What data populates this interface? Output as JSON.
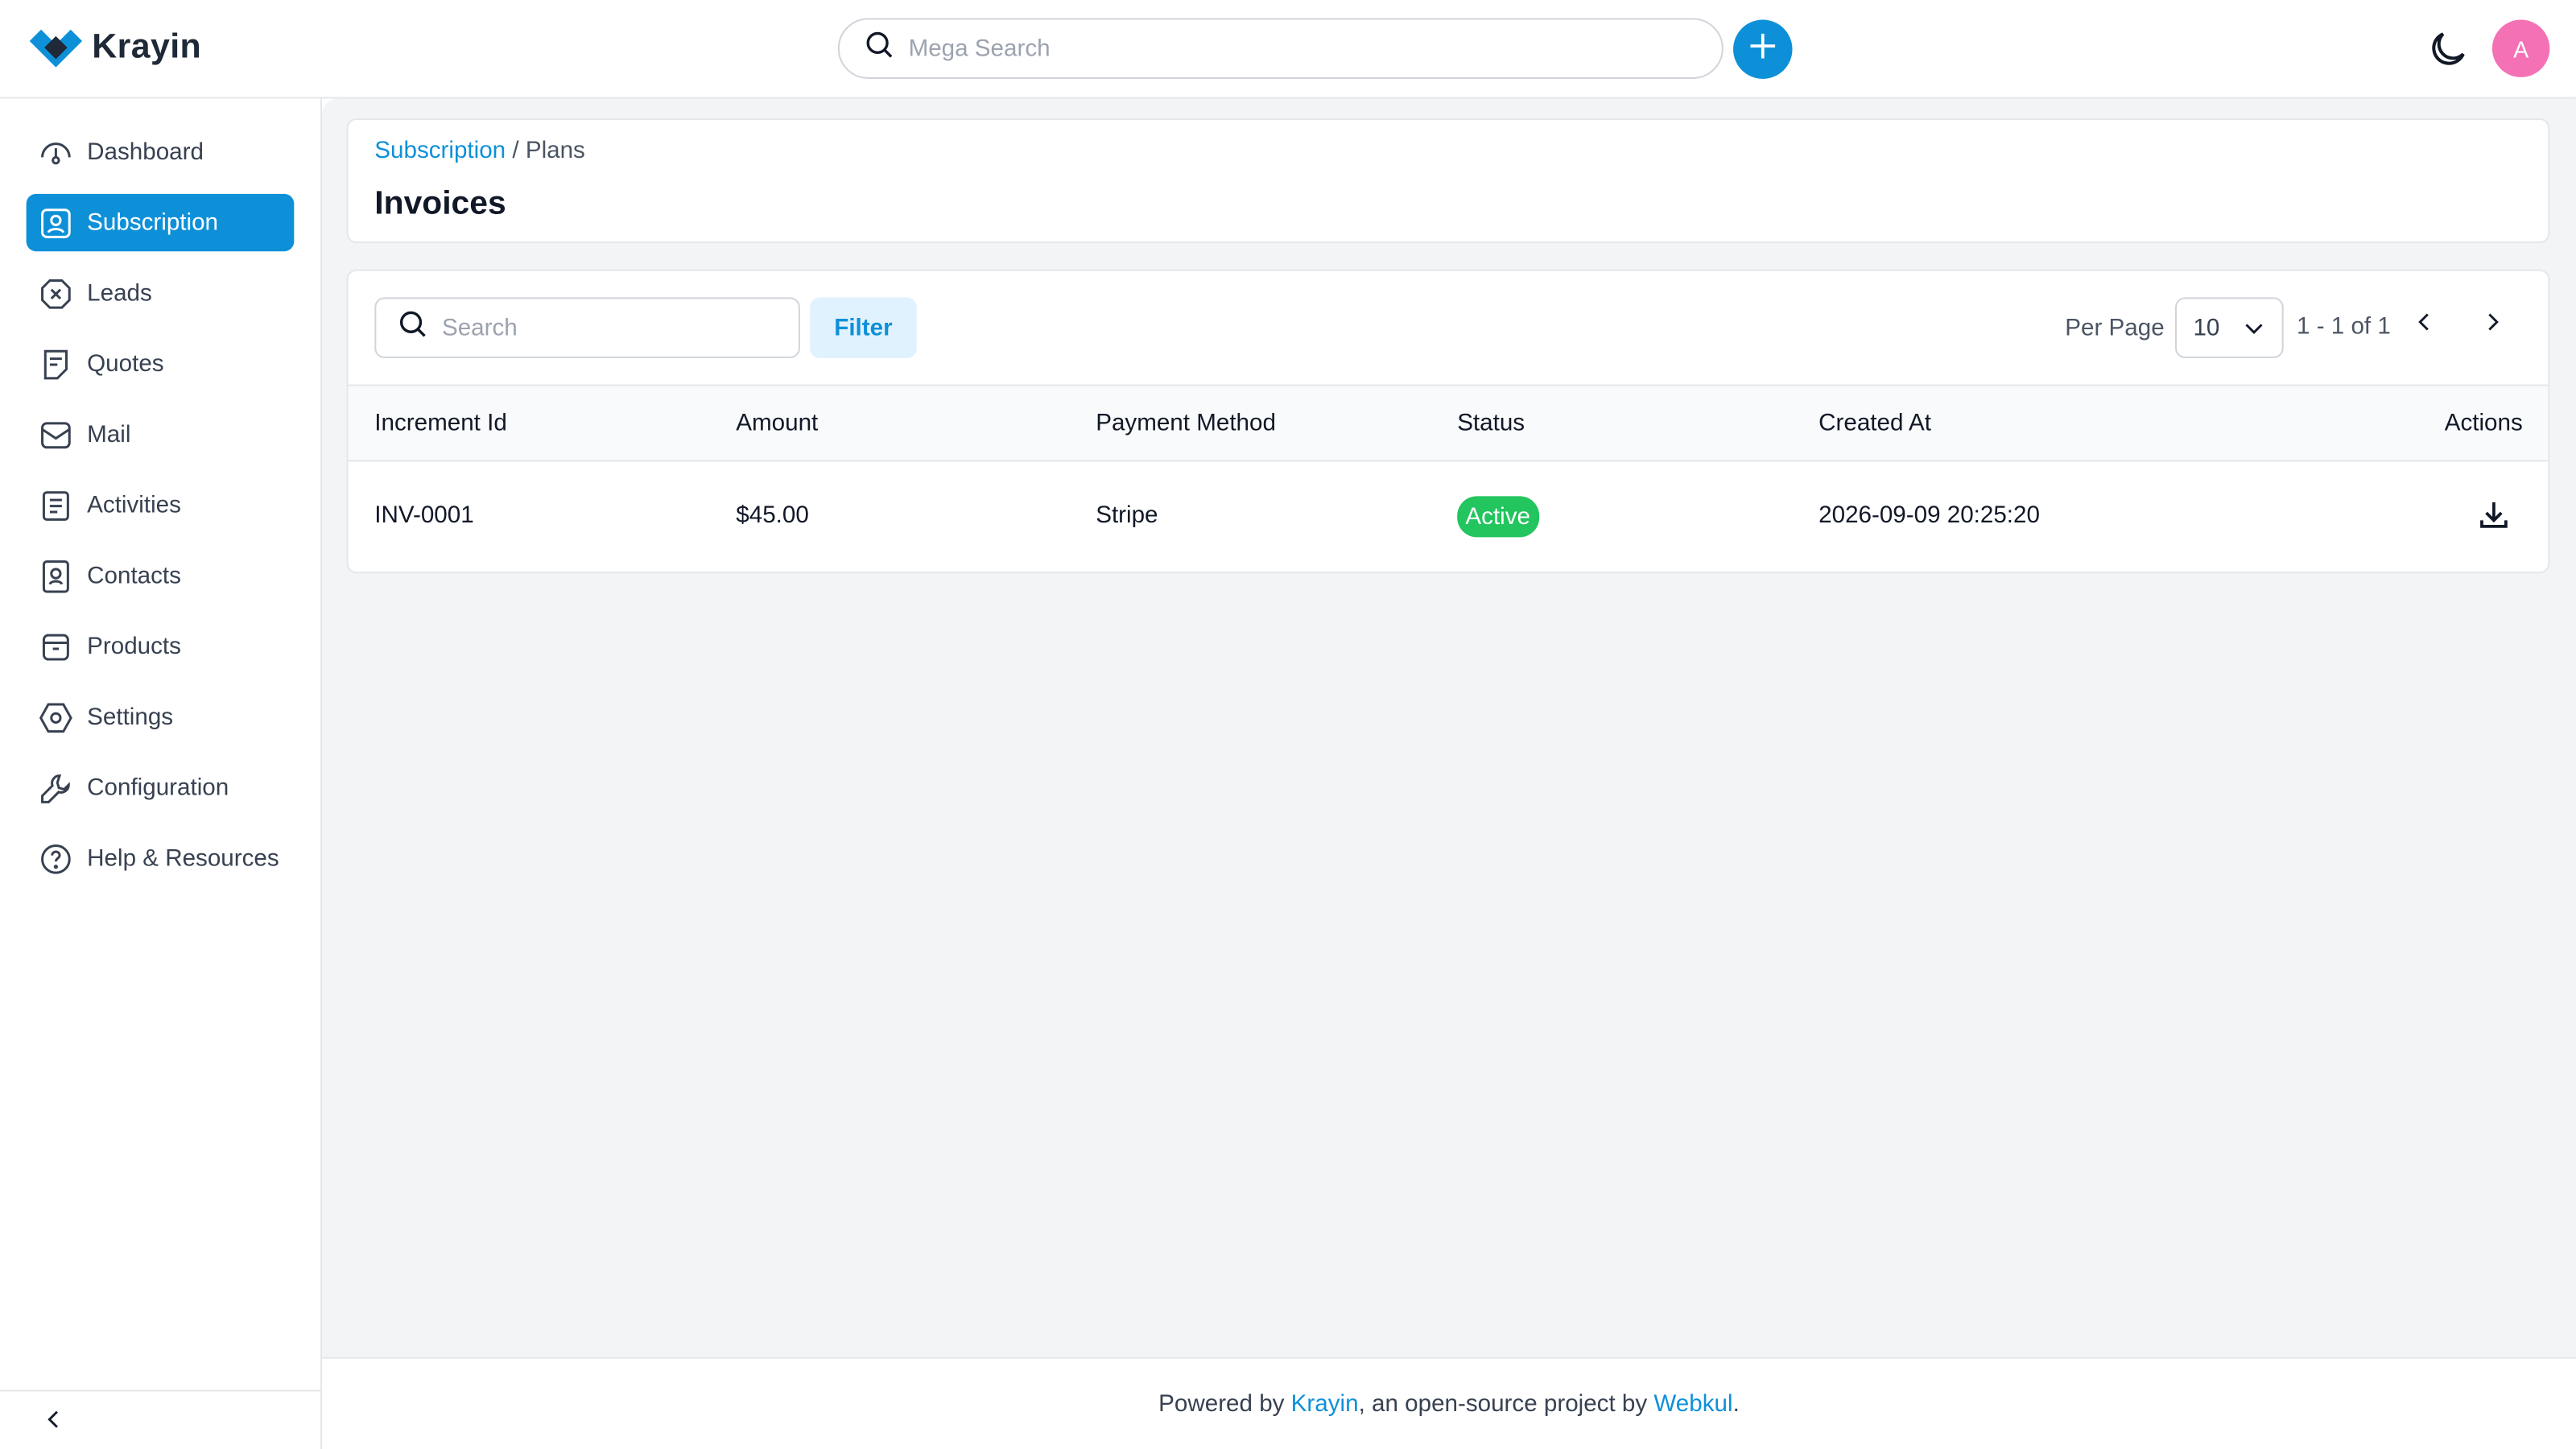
{
  "app": {
    "name": "Krayin",
    "brand_color": "#0e90d9"
  },
  "header": {
    "search_placeholder": "Mega Search",
    "avatar_initial": "A"
  },
  "sidebar": {
    "items": [
      {
        "label": "Dashboard",
        "icon": "dashboard-icon",
        "active": false
      },
      {
        "label": "Subscription",
        "icon": "subscription-icon",
        "active": true
      },
      {
        "label": "Leads",
        "icon": "leads-icon",
        "active": false
      },
      {
        "label": "Quotes",
        "icon": "quotes-icon",
        "active": false
      },
      {
        "label": "Mail",
        "icon": "mail-icon",
        "active": false
      },
      {
        "label": "Activities",
        "icon": "activities-icon",
        "active": false
      },
      {
        "label": "Contacts",
        "icon": "contacts-icon",
        "active": false
      },
      {
        "label": "Products",
        "icon": "products-icon",
        "active": false
      },
      {
        "label": "Settings",
        "icon": "settings-icon",
        "active": false
      },
      {
        "label": "Configuration",
        "icon": "configuration-icon",
        "active": false
      },
      {
        "label": "Help & Resources",
        "icon": "help-icon",
        "active": false
      }
    ]
  },
  "breadcrumb": {
    "parent": "Subscription",
    "separator": "/",
    "current": "Plans"
  },
  "page": {
    "title": "Invoices"
  },
  "toolbar": {
    "search_placeholder": "Search",
    "filter_label": "Filter",
    "per_page_label": "Per Page",
    "per_page_value": "10",
    "page_info": "1 - 1 of 1"
  },
  "table": {
    "columns": [
      "Increment Id",
      "Amount",
      "Payment Method",
      "Status",
      "Created At",
      "Actions"
    ],
    "rows": [
      {
        "increment_id": "INV-0001",
        "amount": "$45.00",
        "payment_method": "Stripe",
        "status": "Active",
        "created_at": "2026-09-09 20:25:20"
      }
    ]
  },
  "footer": {
    "prefix": "Powered by ",
    "link1": "Krayin",
    "middle": ", an open-source project by ",
    "link2": "Webkul",
    "suffix": "."
  }
}
